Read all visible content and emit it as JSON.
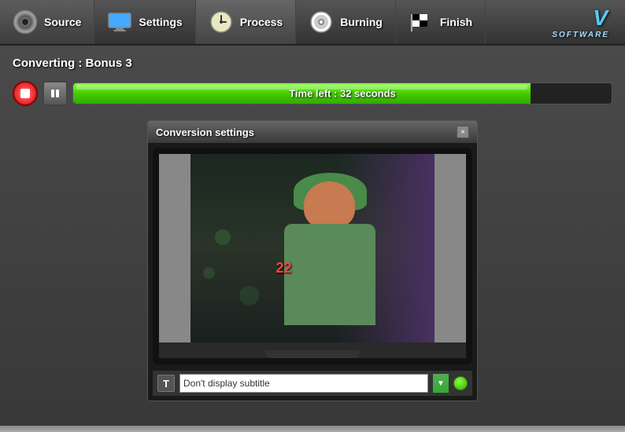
{
  "nav": {
    "items": [
      {
        "id": "source",
        "label": "Source",
        "icon": "dvd-icon",
        "active": false
      },
      {
        "id": "settings",
        "label": "Settings",
        "icon": "monitor-icon",
        "active": false
      },
      {
        "id": "process",
        "label": "Process",
        "icon": "clock-icon",
        "active": true
      },
      {
        "id": "burning",
        "label": "Burning",
        "icon": "disc-icon",
        "active": false
      },
      {
        "id": "finish",
        "label": "Finish",
        "icon": "flag-icon",
        "active": false
      }
    ],
    "brand": "V",
    "brand_sub": "SOFTWARE"
  },
  "main": {
    "converting_label": "Converting : Bonus 3",
    "progress": {
      "time_left": "Time left :  32 seconds",
      "percent": 85,
      "stop_title": "Stop",
      "pause_title": "Pause"
    },
    "conversion_settings": {
      "title": "Conversion settings",
      "close_label": "×",
      "subtitle_text": "Don't display subtitle",
      "subtitle_placeholder": "Don't display subtitle"
    },
    "number": "22"
  }
}
